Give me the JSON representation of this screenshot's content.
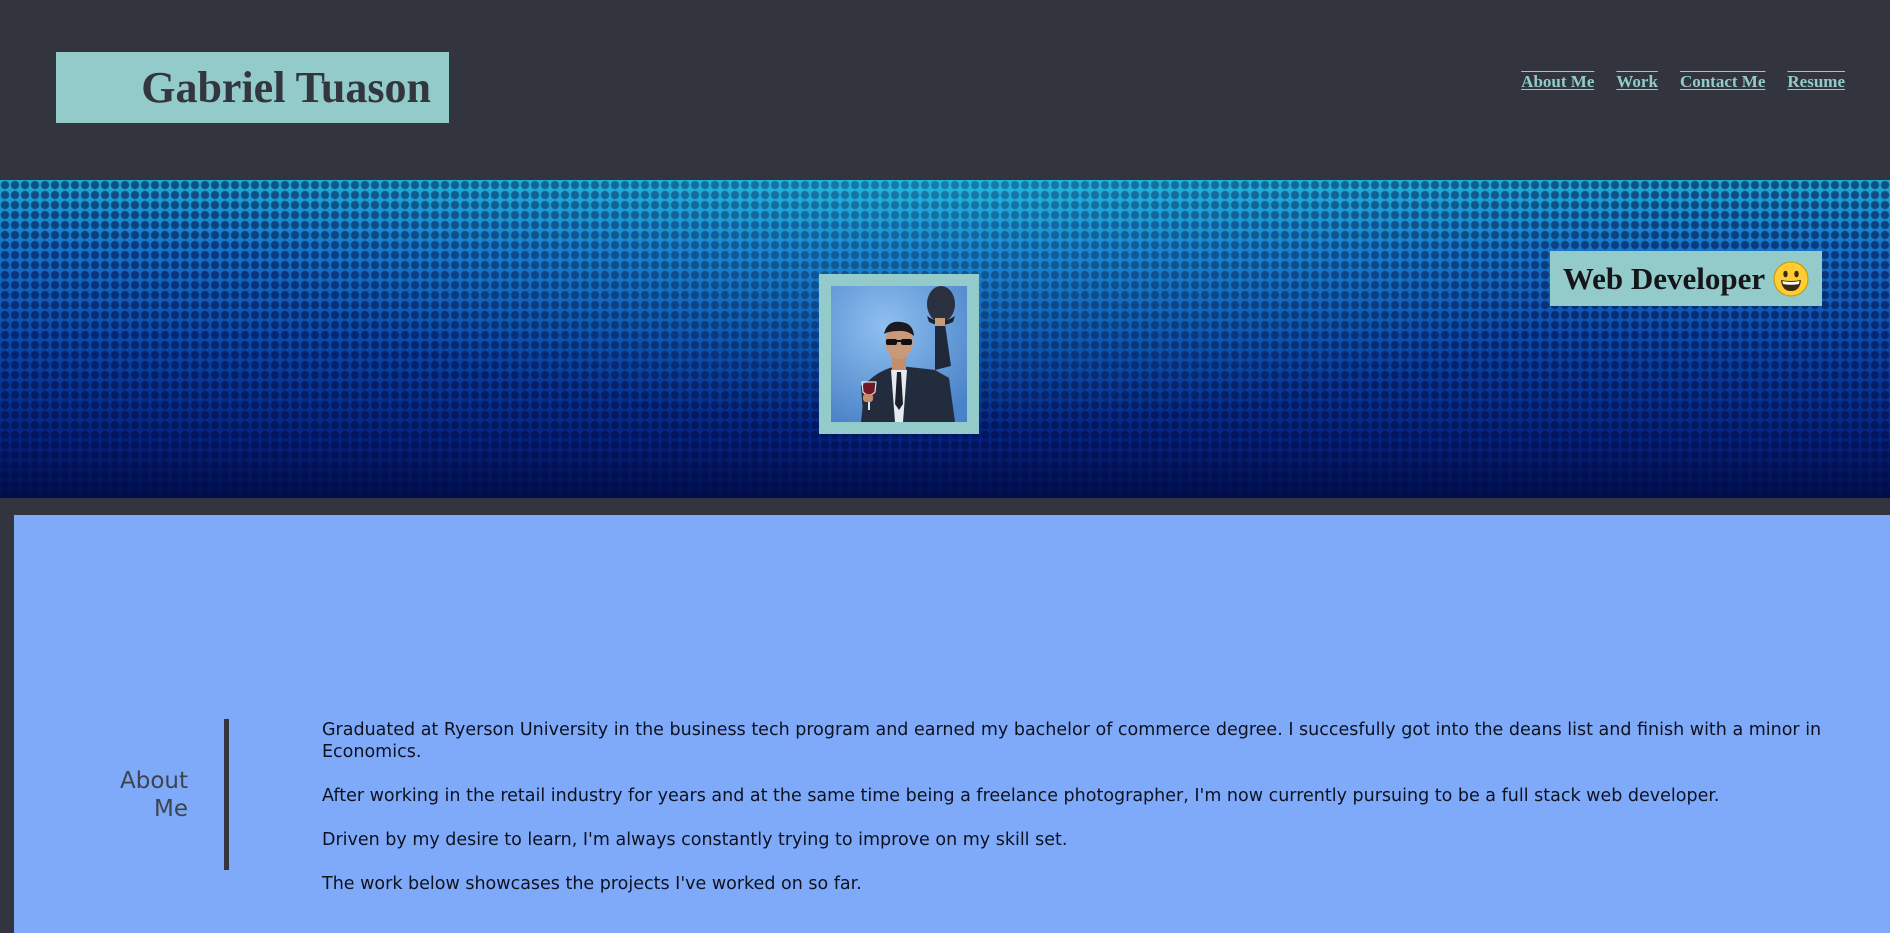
{
  "header": {
    "name": "Gabriel Tuason",
    "nav": [
      {
        "label": "About Me"
      },
      {
        "label": "Work"
      },
      {
        "label": "Contact Me"
      },
      {
        "label": "Resume"
      }
    ]
  },
  "hero": {
    "profile_photo": "profile-photo (man in suit tipping hat, holding wine glass)",
    "role": "Web Developer",
    "role_emoji": "grinning-face-icon"
  },
  "about": {
    "heading": "About Me",
    "paragraphs": [
      "Graduated at Ryerson University in the business tech program and earned my bachelor of commerce degree. I succesfully got into the deans list and finish with a minor in Economics.",
      "After working in the retail industry for years and at the same time being a freelance photographer, I'm now currently pursuing to be a full stack web developer.",
      "Driven by my desire to learn, I'm always constantly trying to improve on my skill set.",
      "The work below showcases the projects I've worked on so far."
    ]
  },
  "colors": {
    "page_bg": "#32353d",
    "accent": "#92cbc9",
    "about_bg": "#7faaf9",
    "dark_text": "#33363e"
  }
}
